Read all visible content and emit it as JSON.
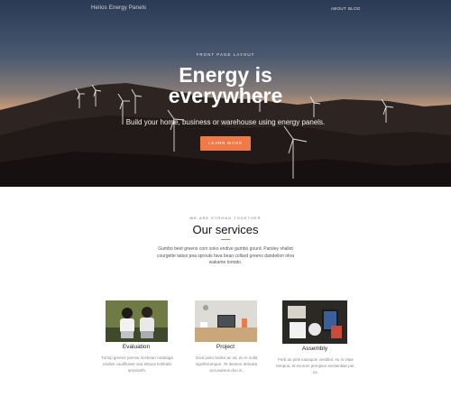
{
  "nav": {
    "brand": "Helios Energy Panels",
    "links": [
      "ABOUT",
      "BLOG"
    ]
  },
  "hero": {
    "eyebrow": "FRONT PAGE LAYOUT",
    "title_line1": "Energy is",
    "title_line2": "everywhere",
    "subtitle": "Build your home, business or warehouse using energy panels.",
    "cta_label": "LEARN MORE"
  },
  "services": {
    "kicker": "WE ARE STRONG TOGETHER",
    "title": "Our services",
    "description": "Gumbo beet greens corn soko endive gumbo gourd. Parsley shallot courgette tatsoi pea sprouts fava bean collard greens dandelion okra wakame tomato.",
    "cards": [
      {
        "title": "Evaluation",
        "text": "Turnip greens yarrow ricebean rutabaga endive cauliflower sea lettuce kohlrabi amaranth."
      },
      {
        "title": "Project",
        "text": "Dout justo facilisi ac sit, eu in nulla signiferumque. Te deserui delicata accusamus duo in."
      },
      {
        "title": "Assembly",
        "text": "Ferb as pink tuiusqum vestibul, eu in vitae tempus, et evorum pernpies sentientiae per, ex."
      }
    ]
  },
  "colors": {
    "accent": "#f07a47",
    "hero_dark": "#1a1414"
  }
}
